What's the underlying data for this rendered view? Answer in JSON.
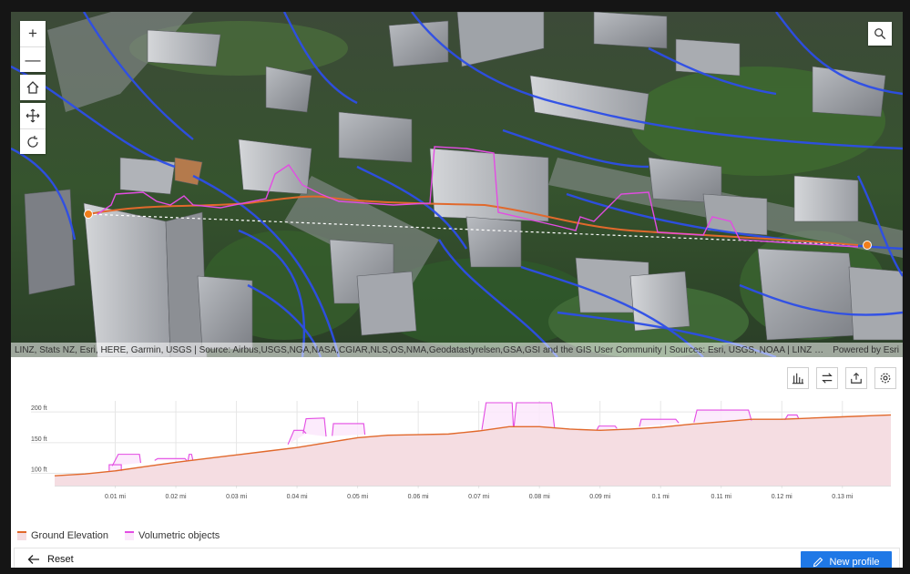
{
  "scene": {
    "attribution": "LINZ, Stats NZ, Esri, HERE, Garmin, USGS | Source: Airbus,USGS,NGA,NASA,CGIAR,NLS,OS,NMA,Geodatastyrelsen,GSA,GSI and the GIS User Community | Sources: Esri, USGS, NOAA | LINZ | Part of Survey Complet...",
    "powered_by": "Powered by Esri",
    "controls": {
      "zoom_in": "+",
      "zoom_out": "—"
    }
  },
  "toolbar": {
    "icons": [
      "bar-chart-icon",
      "swap-icon",
      "export-icon",
      "settings-icon"
    ]
  },
  "chart_data": {
    "type": "area",
    "xlabel": "",
    "ylabel": "",
    "x_ticks": [
      "0.01 mi",
      "0.02 mi",
      "0.03 mi",
      "0.04 mi",
      "0.05 mi",
      "0.06 mi",
      "0.07 mi",
      "0.08 mi",
      "0.09 mi",
      "0.1 mi",
      "0.11 mi",
      "0.12 mi",
      "0.13 mi"
    ],
    "y_ticks": [
      "200 ft",
      "150 ft",
      "100 ft"
    ],
    "xlim": [
      0,
      0.138
    ],
    "ylim": [
      80,
      215
    ],
    "series": [
      {
        "name": "Ground Elevation",
        "color": "#e1692c",
        "fill": "#f5dde2",
        "x": [
          0,
          0.005,
          0.01,
          0.015,
          0.02,
          0.025,
          0.03,
          0.035,
          0.04,
          0.045,
          0.05,
          0.055,
          0.06,
          0.065,
          0.07,
          0.075,
          0.08,
          0.085,
          0.09,
          0.095,
          0.1,
          0.105,
          0.11,
          0.115,
          0.12,
          0.125,
          0.13,
          0.135,
          0.138
        ],
        "values": [
          96,
          99,
          104,
          111,
          118,
          124,
          130,
          136,
          142,
          150,
          158,
          162,
          163,
          164,
          169,
          176,
          176,
          172,
          170,
          172,
          175,
          180,
          184,
          188,
          188,
          190,
          192,
          194,
          195
        ]
      },
      {
        "name": "Volumetric objects",
        "color": "#e34ce3",
        "fill": "#fbe8fb",
        "segments": [
          [
            [
              0.009,
              104
            ],
            [
              0.009,
              114
            ],
            [
              0.011,
              114
            ],
            [
              0.011,
              104
            ]
          ],
          [
            [
              0.0095,
              112
            ],
            [
              0.0105,
              131
            ],
            [
              0.014,
              131
            ],
            [
              0.0142,
              117
            ]
          ],
          [
            [
              0.0165,
              121
            ],
            [
              0.017,
              124
            ],
            [
              0.0215,
              124
            ],
            [
              0.0218,
              121
            ]
          ],
          [
            [
              0.022,
              121
            ],
            [
              0.0222,
              131
            ],
            [
              0.0226,
              131
            ],
            [
              0.0228,
              122
            ]
          ],
          [
            [
              0.0385,
              147
            ],
            [
              0.0395,
              170
            ],
            [
              0.041,
              170
            ],
            [
              0.0415,
              165
            ]
          ],
          [
            [
              0.041,
              165
            ],
            [
              0.0415,
              189
            ],
            [
              0.0445,
              190
            ],
            [
              0.0448,
              160
            ]
          ],
          [
            [
              0.0458,
              161
            ],
            [
              0.046,
              181
            ],
            [
              0.051,
              181
            ],
            [
              0.0512,
              163
            ]
          ],
          [
            [
              0.0705,
              171
            ],
            [
              0.0712,
              215
            ],
            [
              0.0755,
              215
            ],
            [
              0.0757,
              175
            ]
          ],
          [
            [
              0.0758,
              175
            ],
            [
              0.0762,
              215
            ],
            [
              0.082,
              215
            ],
            [
              0.0825,
              174
            ]
          ],
          [
            [
              0.0895,
              171
            ],
            [
              0.0898,
              177
            ],
            [
              0.0925,
              177
            ],
            [
              0.0928,
              173
            ]
          ],
          [
            [
              0.0965,
              176
            ],
            [
              0.0968,
              188
            ],
            [
              0.1025,
              188
            ],
            [
              0.103,
              182
            ]
          ],
          [
            [
              0.1055,
              183
            ],
            [
              0.106,
              203
            ],
            [
              0.1145,
              203
            ],
            [
              0.115,
              186
            ]
          ],
          [
            [
              0.1205,
              187
            ],
            [
              0.121,
              195
            ],
            [
              0.1225,
              195
            ],
            [
              0.1228,
              189
            ]
          ]
        ]
      }
    ]
  },
  "legend": {
    "ground": "Ground Elevation",
    "volume": "Volumetric objects"
  },
  "footer": {
    "reset_label": "Reset",
    "new_profile_label": "New profile"
  }
}
